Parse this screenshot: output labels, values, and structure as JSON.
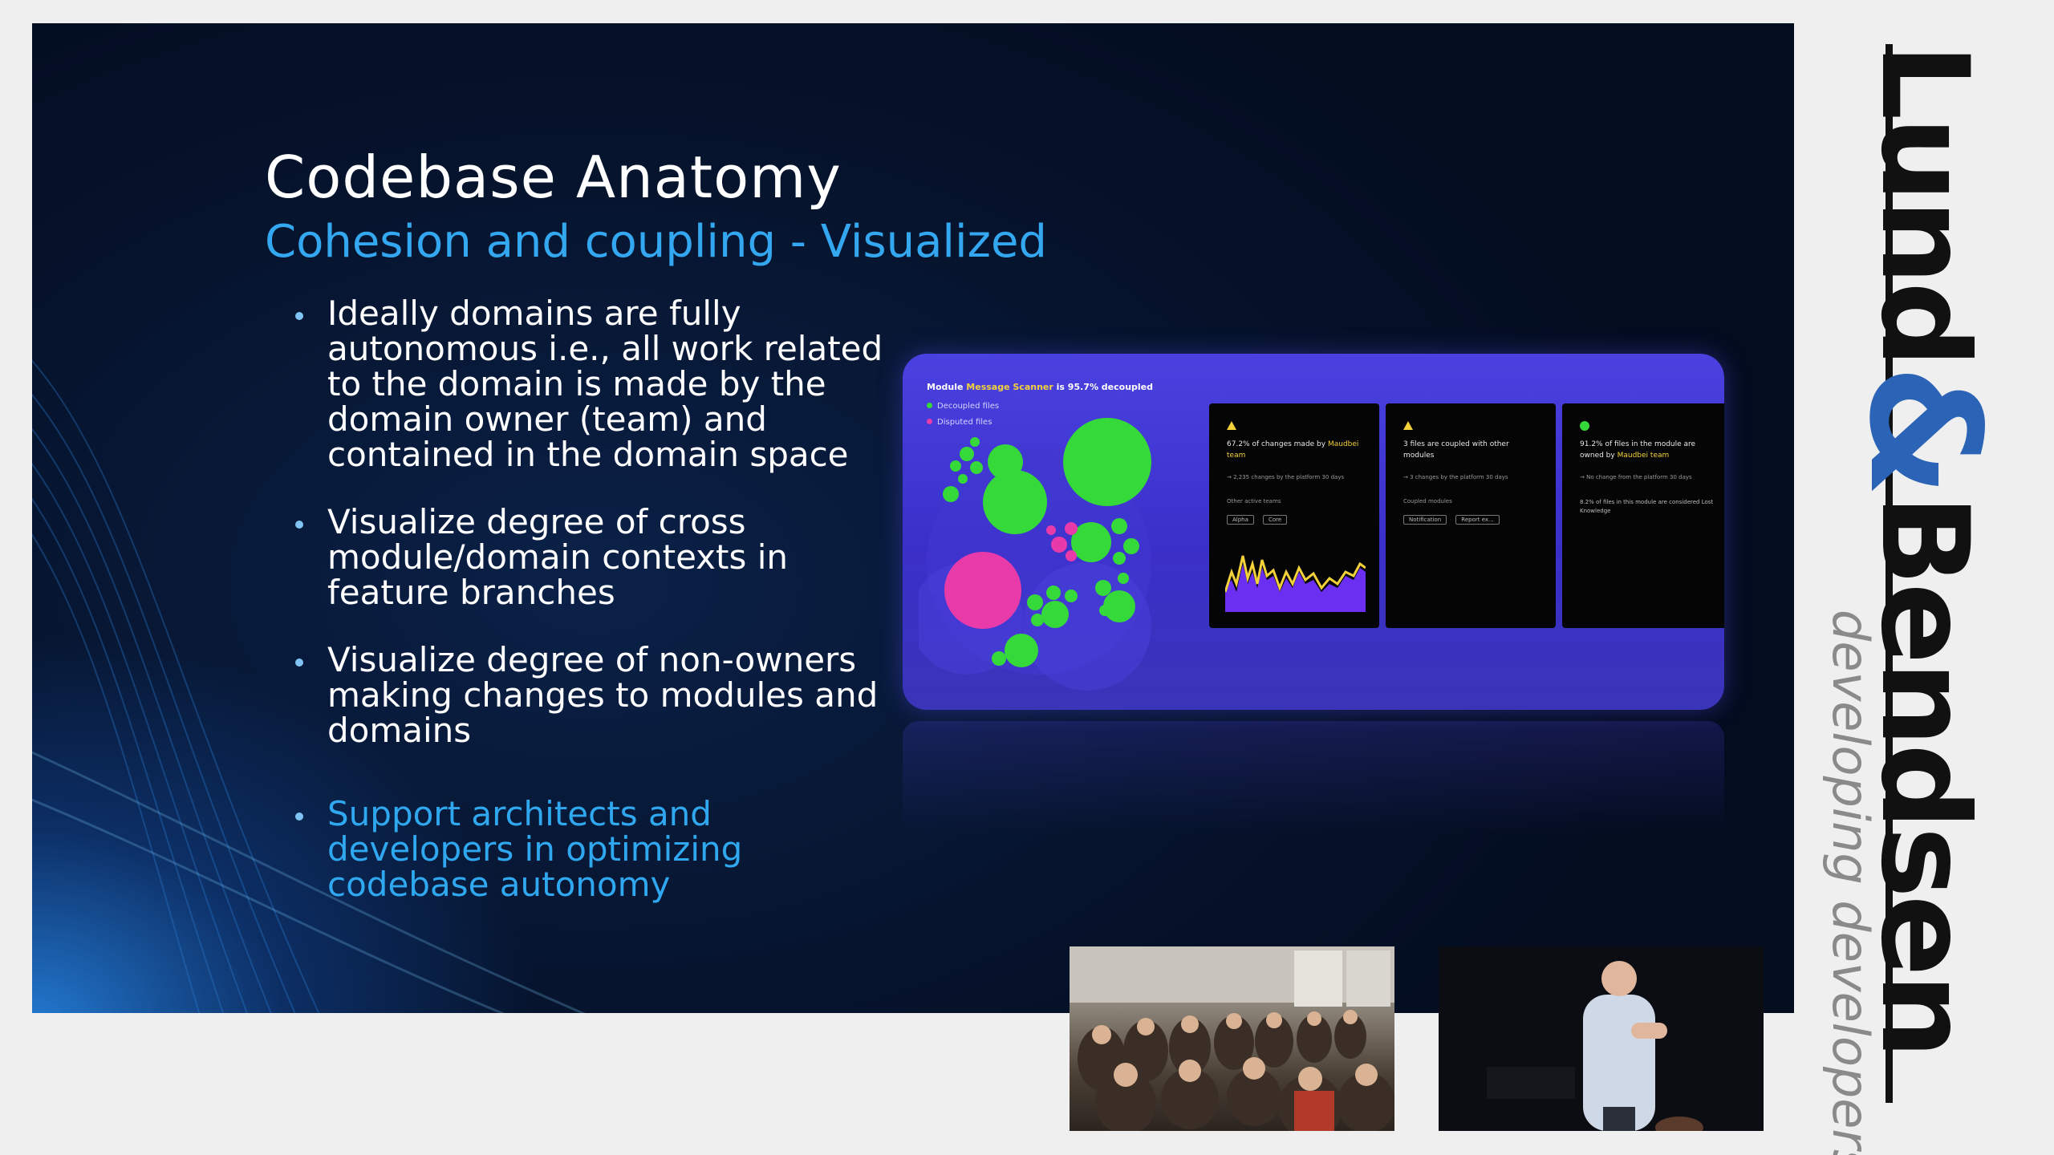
{
  "slide": {
    "title": "Codebase Anatomy",
    "subtitle": "Cohesion and coupling - Visualized",
    "bullets": [
      "Ideally domains are fully autonomous i.e., all work related to the domain is made by the domain owner (team) and contained in the domain space",
      "Visualize degree of cross module/domain contexts in feature branches",
      "Visualize degree of non-owners making changes to modules and domains"
    ],
    "accent_bullet": "Support architects and developers in optimizing codebase autonomy"
  },
  "screenshot": {
    "header_prefix": "Module",
    "header_module": "Message Scanner",
    "header_suffix": "is 95.7% decoupled",
    "legend": [
      {
        "label": "Decoupled files",
        "color": "#35d93a"
      },
      {
        "label": "Disputed files",
        "color": "#e83aa8"
      }
    ],
    "cards": [
      {
        "icon": "warning-triangle-icon",
        "text_prefix": "67.2% of changes made by",
        "text_highlight": "Maudbei team",
        "small": "→ 2,235 changes by the platform 30 days",
        "sublabel": "Other active teams",
        "tags": [
          "Alpha",
          "Core"
        ]
      },
      {
        "icon": "warning-triangle-icon",
        "text_prefix": "3 files are coupled with other modules",
        "text_highlight": "",
        "small": "→ 3 changes by the platform 30 days",
        "sublabel": "Coupled modules",
        "tags": [
          "Notification",
          "Report ex..."
        ]
      },
      {
        "icon": "status-dot-icon",
        "text_prefix": "91.2% of files in the module are owned by",
        "text_highlight": "Maudbei team",
        "small": "→ No change from the platform 30 days",
        "sublabel": "8.2% of files in this module are considered Lost Knowledge",
        "tags": []
      }
    ]
  },
  "brand": {
    "name_part1": "Lund",
    "ampersand": "&",
    "name_part2": "Bendsen",
    "tagline": "developing developers",
    "accent_color": "#2b63b6"
  },
  "colors": {
    "subtitle": "#33a7ef",
    "accent_bullet": "#2fa8f0",
    "screenshot_bg": "#4a41e0"
  }
}
